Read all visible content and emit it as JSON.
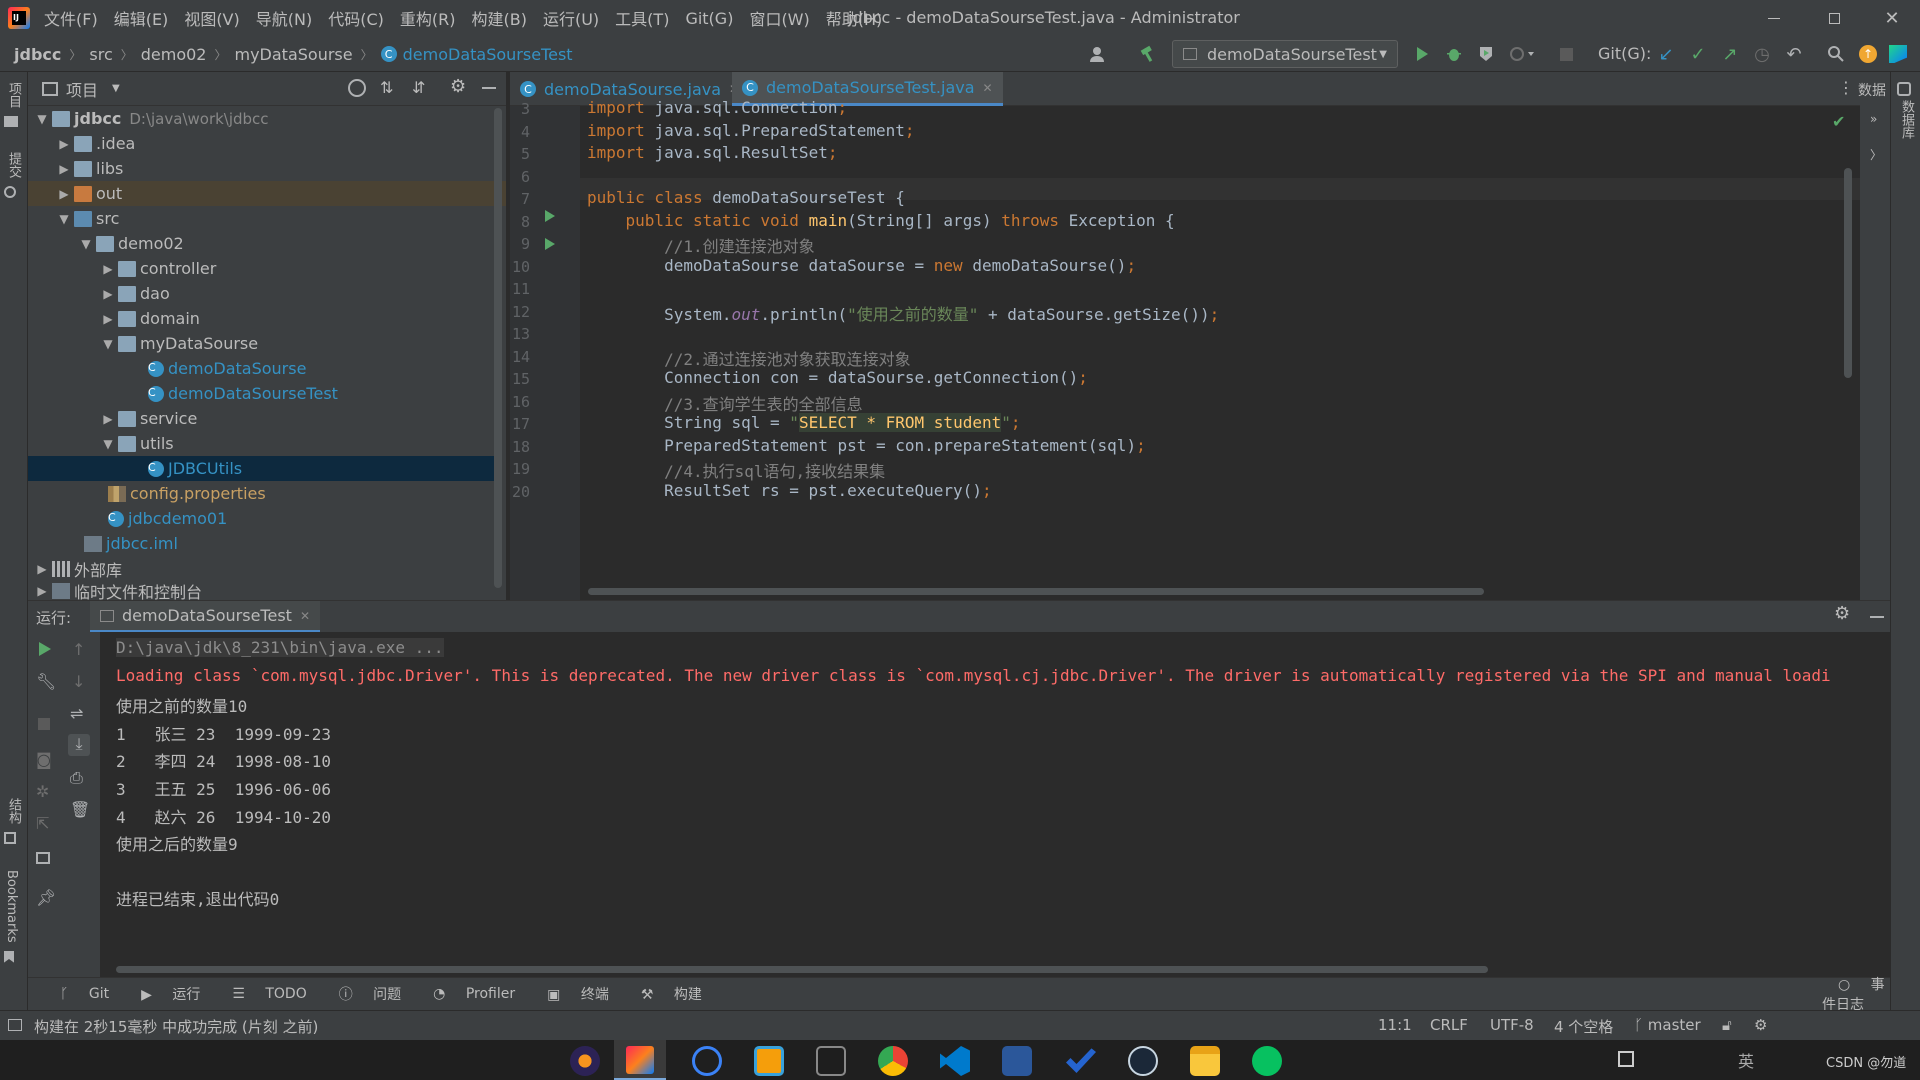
{
  "window": {
    "title": "jdbcc - demoDataSourseTest.java - Administrator",
    "menu": [
      "文件(F)",
      "编辑(E)",
      "视图(V)",
      "导航(N)",
      "代码(C)",
      "重构(R)",
      "构建(B)",
      "运行(U)",
      "工具(T)",
      "Git(G)",
      "窗口(W)",
      "帮助(H)"
    ]
  },
  "nav": {
    "crumbs": [
      "jdbcc",
      "src",
      "demo02",
      "myDataSourse",
      "demoDataSourseTest"
    ],
    "run_config": "demoDataSourseTest",
    "git_label": "Git(G):"
  },
  "left_strip": {
    "items": [
      "项目",
      "提交",
      "结构",
      "Bookmarks"
    ]
  },
  "right_strip": {
    "label_top": "数据",
    "label_side": "数据库"
  },
  "project": {
    "title": "项目",
    "root_name": "jdbcc",
    "root_path": "D:\\java\\work\\jdbcc",
    "items": [
      {
        "label": ".idea"
      },
      {
        "label": "libs"
      },
      {
        "label": "out"
      },
      {
        "label": "src"
      },
      {
        "label": "demo02"
      },
      {
        "label": "controller"
      },
      {
        "label": "dao"
      },
      {
        "label": "domain"
      },
      {
        "label": "myDataSourse"
      },
      {
        "label": "demoDataSourse"
      },
      {
        "label": "demoDataSourseTest"
      },
      {
        "label": "service"
      },
      {
        "label": "utils"
      },
      {
        "label": "JDBCUtils"
      },
      {
        "label": "config.properties"
      },
      {
        "label": "jdbcdemo01"
      },
      {
        "label": "jdbcc.iml"
      },
      {
        "label": "外部库"
      },
      {
        "label": "临时文件和控制台"
      }
    ]
  },
  "editor": {
    "tabs": [
      "demoDataSourse.java",
      "demoDataSourseTest.java"
    ],
    "lines": [
      {
        "n": "3",
        "segs": [
          {
            "t": "import ",
            "c": "kw"
          },
          {
            "t": "java.sql.Connection",
            "c": ""
          },
          {
            "t": ";",
            "c": "kw"
          }
        ]
      },
      {
        "n": "4",
        "segs": [
          {
            "t": "import ",
            "c": "kw"
          },
          {
            "t": "java.sql.PreparedStatement",
            "c": ""
          },
          {
            "t": ";",
            "c": "kw"
          }
        ]
      },
      {
        "n": "5",
        "segs": [
          {
            "t": "import ",
            "c": "kw"
          },
          {
            "t": "java.sql.ResultSet",
            "c": ""
          },
          {
            "t": ";",
            "c": "kw"
          }
        ]
      },
      {
        "n": "6",
        "segs": []
      },
      {
        "n": "7",
        "segs": [
          {
            "t": "public class ",
            "c": "kw"
          },
          {
            "t": "demoDataSourseTest {",
            "c": ""
          }
        ]
      },
      {
        "n": "8",
        "segs": [
          {
            "t": "    public static void ",
            "c": "kw"
          },
          {
            "t": "main",
            "c": "fn"
          },
          {
            "t": "(String[] args) ",
            "c": ""
          },
          {
            "t": "throws ",
            "c": "kw"
          },
          {
            "t": "Exception {",
            "c": ""
          }
        ]
      },
      {
        "n": "9",
        "segs": [
          {
            "t": "        //1.创建连接池对象",
            "c": "cm"
          }
        ]
      },
      {
        "n": "10",
        "segs": [
          {
            "t": "        demoDataSourse dataSourse = ",
            "c": ""
          },
          {
            "t": "new ",
            "c": "kw"
          },
          {
            "t": "demoDataSourse()",
            "c": ""
          },
          {
            "t": ";",
            "c": "kw"
          }
        ]
      },
      {
        "n": "11",
        "segs": []
      },
      {
        "n": "12",
        "segs": [
          {
            "t": "        System.",
            "c": ""
          },
          {
            "t": "out",
            "c": "it"
          },
          {
            "t": ".println(",
            "c": ""
          },
          {
            "t": "\"使用之前的数量\"",
            "c": "str"
          },
          {
            "t": " + dataSourse.getSize())",
            "c": ""
          },
          {
            "t": ";",
            "c": "kw"
          }
        ]
      },
      {
        "n": "13",
        "segs": []
      },
      {
        "n": "14",
        "segs": [
          {
            "t": "        //2.通过连接池对象获取连接对象",
            "c": "cm"
          }
        ]
      },
      {
        "n": "15",
        "segs": [
          {
            "t": "        Connection con = dataSourse.getConnection()",
            "c": ""
          },
          {
            "t": ";",
            "c": "kw"
          }
        ]
      },
      {
        "n": "16",
        "segs": [
          {
            "t": "        //3.查询学生表的全部信息",
            "c": "cm"
          }
        ]
      },
      {
        "n": "17",
        "segs": [
          {
            "t": "        String sql = ",
            "c": ""
          },
          {
            "t": "\"",
            "c": "str"
          },
          {
            "t": "SELECT * FROM student",
            "c": "sql"
          },
          {
            "t": "\"",
            "c": "str"
          },
          {
            "t": ";",
            "c": "kw"
          }
        ]
      },
      {
        "n": "18",
        "segs": [
          {
            "t": "        PreparedStatement pst = con.prepareStatement(sql)",
            "c": ""
          },
          {
            "t": ";",
            "c": "kw"
          }
        ]
      },
      {
        "n": "19",
        "segs": [
          {
            "t": "        //4.执行sql语句,接收结果集",
            "c": "cm"
          }
        ]
      },
      {
        "n": "20",
        "segs": [
          {
            "t": "        ResultSet rs = pst.executeQuery()",
            "c": ""
          },
          {
            "t": ";",
            "c": "kw"
          }
        ]
      }
    ]
  },
  "run": {
    "label": "运行:",
    "tab": "demoDataSourseTest",
    "console": [
      {
        "t": "D:\\java\\jdk\\8_231\\bin\\java.exe ...",
        "c": "cmd"
      },
      {
        "t": "Loading class `com.mysql.jdbc.Driver'. This is deprecated. The new driver class is `com.mysql.cj.jdbc.Driver'. The driver is automatically registered via the SPI and manual loadi",
        "c": "err"
      },
      {
        "t": "使用之前的数量10",
        "c": ""
      },
      {
        "t": "1   张三 23  1999-09-23",
        "c": ""
      },
      {
        "t": "2   李四 24  1998-08-10",
        "c": ""
      },
      {
        "t": "3   王五 25  1996-06-06",
        "c": ""
      },
      {
        "t": "4   赵六 26  1994-10-20",
        "c": ""
      },
      {
        "t": "使用之后的数量9",
        "c": ""
      },
      {
        "t": "",
        "c": ""
      },
      {
        "t": "进程已结束,退出代码0",
        "c": ""
      }
    ]
  },
  "toolwindows": {
    "items": [
      "Git",
      "运行",
      "TODO",
      "问题",
      "Profiler",
      "终端",
      "构建"
    ],
    "event_log": "事件日志"
  },
  "status": {
    "message": "构建在 2秒15毫秒 中成功完成 (片刻 之前)",
    "position": "11:1",
    "line_sep": "CRLF",
    "encoding": "UTF-8",
    "indent": "4 个空格",
    "branch": "master"
  },
  "taskbar": {
    "lang": "英",
    "watermark": "CSDN @勿道"
  },
  "colors": {
    "accent": "#3592c4",
    "error": "#ff6b68",
    "run_green": "#59a869"
  }
}
